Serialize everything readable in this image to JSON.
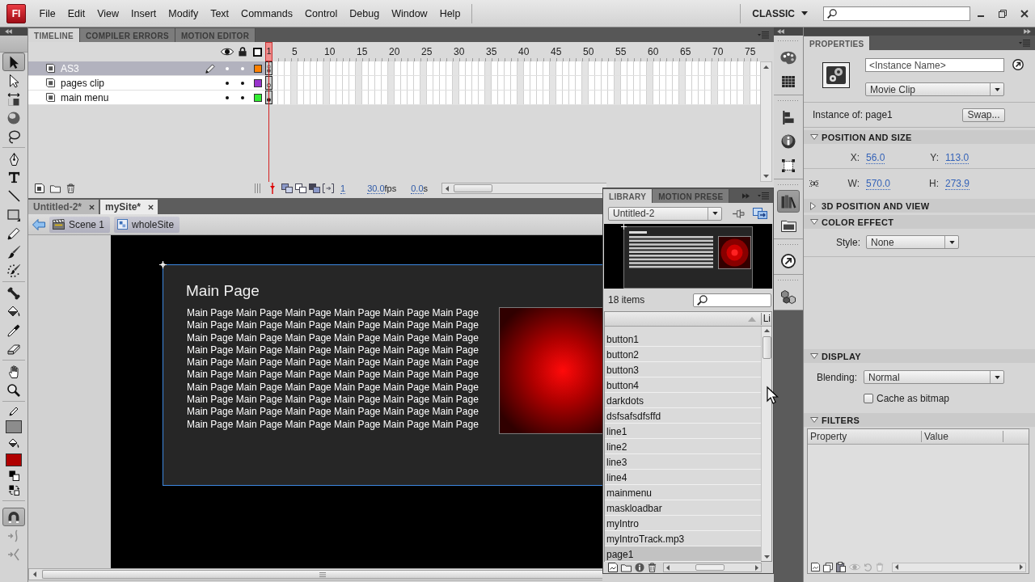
{
  "menubar": {
    "logo": "Fl",
    "menus": [
      "File",
      "Edit",
      "View",
      "Insert",
      "Modify",
      "Text",
      "Commands",
      "Control",
      "Debug",
      "Window",
      "Help"
    ],
    "workspace": "CLASSIC"
  },
  "tools": [
    [
      {
        "kind": "selection",
        "selected": true
      },
      {
        "kind": "subselection",
        "selected": false
      },
      {
        "kind": "free_transform",
        "selected": false
      },
      {
        "kind": "rotation_3d",
        "selected": false
      },
      {
        "kind": "lasso",
        "selected": false
      }
    ],
    [
      {
        "kind": "pen",
        "selected": false
      },
      {
        "kind": "text",
        "selected": false
      },
      {
        "kind": "line",
        "selected": false
      },
      {
        "kind": "rectangle",
        "selected": false
      },
      {
        "kind": "pencil",
        "selected": false
      },
      {
        "kind": "brush",
        "selected": false
      },
      {
        "kind": "deco",
        "selected": false
      }
    ],
    [
      {
        "kind": "bone",
        "selected": false
      },
      {
        "kind": "paint_bucket",
        "selected": false
      },
      {
        "kind": "eyedropper",
        "selected": false
      },
      {
        "kind": "eraser",
        "selected": false
      }
    ],
    [
      {
        "kind": "hand",
        "selected": false
      },
      {
        "kind": "zoom",
        "selected": false
      }
    ]
  ],
  "colors": [
    {
      "kind": "stroke",
      "color": "#8c8c8c"
    },
    {
      "kind": "fill",
      "color": "#b00000"
    }
  ],
  "tool_options": [
    {
      "kind": "snap",
      "on": true,
      "disabled": false
    },
    {
      "kind": "smooth",
      "on": false,
      "disabled": true
    },
    {
      "kind": "straighten",
      "on": false,
      "disabled": true
    }
  ],
  "timeline": {
    "tabs": [
      {
        "label": "TIMELINE",
        "selected": true
      },
      {
        "label": "COMPILER ERRORS",
        "selected": false
      },
      {
        "label": "MOTION EDITOR",
        "selected": false
      }
    ],
    "playhead": "1",
    "ruler": [
      "5",
      "10",
      "15",
      "20",
      "25",
      "30",
      "35",
      "40",
      "45",
      "50",
      "55",
      "60",
      "65",
      "70",
      "75"
    ],
    "layers": [
      {
        "name": "AS3",
        "selected": true,
        "editing": true,
        "visible": true,
        "locked": false,
        "color": "#ff8000",
        "frames": [
          {
            "kind": "script"
          }
        ]
      },
      {
        "name": "pages clip",
        "selected": false,
        "editing": false,
        "visible": true,
        "locked": false,
        "color": "#9933cc",
        "frames": [
          {
            "kind": "empty"
          }
        ]
      },
      {
        "name": "main menu",
        "selected": false,
        "editing": false,
        "visible": true,
        "locked": false,
        "color": "#33ee33",
        "frames": [
          {
            "kind": "filled"
          }
        ]
      }
    ],
    "current_frame": "1",
    "frame_rate": "30.0",
    "frame_rate_unit": "fps",
    "elapsed_time": "0.0",
    "elapsed_time_unit": "s"
  },
  "document": {
    "tabs": [
      {
        "label": "Untitled-2*",
        "selected": false
      },
      {
        "label": "mySite*",
        "selected": true
      }
    ],
    "breadcrumb": [
      {
        "label": "Scene 1",
        "kind": "scene"
      },
      {
        "label": "wholeSite",
        "kind": "symbol"
      }
    ],
    "clip": {
      "heading": "Main Page",
      "lines": [
        "Main Page Main Page Main Page Main Page Main Page Main Page",
        "Main Page Main Page Main Page Main Page Main Page Main Page",
        "Main Page Main Page Main Page Main Page Main Page Main Page",
        "Main Page Main Page Main Page Main Page Main Page Main Page",
        "Main Page Main Page Main Page Main Page Main Page Main Page",
        "Main Page Main Page Main Page Main Page Main Page Main Page",
        "Main Page Main Page Main Page Main Page Main Page Main Page",
        "Main Page Main Page Main Page Main Page Main Page Main Page",
        "Main Page Main Page Main Page Main Page Main Page Main Page",
        "Main Page Main Page Main Page Main Page Main Page Main Page"
      ]
    }
  },
  "library": {
    "tabs": [
      {
        "label": "LIBRARY",
        "selected": true
      },
      {
        "label": "MOTION PRESE",
        "selected": false
      }
    ],
    "document": "Untitled-2",
    "count": "18 items",
    "column_2": "Li",
    "items": [
      {
        "name": "button1",
        "selected": false
      },
      {
        "name": "button2",
        "selected": false
      },
      {
        "name": "button3",
        "selected": false
      },
      {
        "name": "button4",
        "selected": false
      },
      {
        "name": "darkdots",
        "selected": false
      },
      {
        "name": "dsfsafsdfsffd",
        "selected": false
      },
      {
        "name": "line1",
        "selected": false
      },
      {
        "name": "line2",
        "selected": false
      },
      {
        "name": "line3",
        "selected": false
      },
      {
        "name": "line4",
        "selected": false
      },
      {
        "name": "mainmenu",
        "selected": false
      },
      {
        "name": "maskloadbar",
        "selected": false
      },
      {
        "name": "myIntro",
        "selected": false
      },
      {
        "name": "myIntroTrack.mp3",
        "selected": false
      },
      {
        "name": "page1",
        "selected": true
      }
    ]
  },
  "panel_icons": [
    [
      {
        "kind": "palette",
        "selected": false
      },
      {
        "kind": "grid",
        "selected": false
      }
    ],
    [
      {
        "kind": "align",
        "selected": false
      },
      {
        "kind": "info",
        "selected": false
      },
      {
        "kind": "transform",
        "selected": false
      }
    ],
    [
      {
        "kind": "library",
        "selected": true
      },
      {
        "kind": "folder",
        "selected": false
      }
    ],
    [
      {
        "kind": "arrow_circle",
        "selected": false
      }
    ],
    [
      {
        "kind": "cubes",
        "selected": false
      }
    ]
  ],
  "properties": {
    "tabs": [
      {
        "label": "PROPERTIES",
        "selected": true
      }
    ],
    "instance_name": {
      "placeholder": "<Instance Name>"
    },
    "symbol_type": "Movie Clip",
    "instance_of": "Instance of: page1",
    "swap": "Swap...",
    "sections": [
      {
        "kind": "position",
        "title": "POSITION AND SIZE",
        "expanded": true,
        "fields": [
          {
            "label": "X:",
            "value": "56.0"
          },
          {
            "label": "Y:",
            "value": "113.0"
          },
          {
            "label": "W:",
            "value": "570.0"
          },
          {
            "label": "H:",
            "value": "273.9"
          }
        ]
      },
      {
        "kind": "perspective",
        "title": "3D POSITION AND VIEW",
        "expanded": false
      },
      {
        "kind": "color_effect",
        "title": "COLOR EFFECT",
        "expanded": true,
        "style_label": "Style:",
        "style": "None"
      },
      {
        "kind": "display",
        "title": "DISPLAY",
        "expanded": true,
        "blending_label": "Blending:",
        "blending": "Normal",
        "cache_label": "Cache as bitmap",
        "cache_checked": false
      },
      {
        "kind": "filters",
        "title": "FILTERS",
        "expanded": true,
        "columns": [
          "Property",
          "Value"
        ]
      }
    ]
  }
}
